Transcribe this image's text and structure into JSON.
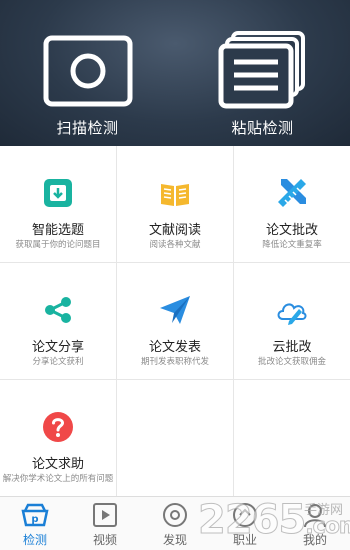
{
  "header": {
    "scan_label": "扫描检测",
    "paste_label": "粘贴检测"
  },
  "grid": {
    "items": [
      {
        "title": "智能选题",
        "subtitle": "获取属于你的论问题目",
        "icon": "topic-icon"
      },
      {
        "title": "文献阅读",
        "subtitle": "阅读各种文献",
        "icon": "book-icon"
      },
      {
        "title": "论文批改",
        "subtitle": "降低论文重复率",
        "icon": "pencil-ruler-icon"
      },
      {
        "title": "论文分享",
        "subtitle": "分享论文获利",
        "icon": "share-icon"
      },
      {
        "title": "论文发表",
        "subtitle": "期刊发表职称代发",
        "icon": "paper-plane-icon"
      },
      {
        "title": "云批改",
        "subtitle": "批改论文获取佣金",
        "icon": "cloud-pen-icon"
      },
      {
        "title": "论文求助",
        "subtitle": "解决你学术论文上的所有问题",
        "icon": "help-icon"
      }
    ]
  },
  "tabbar": {
    "tabs": [
      {
        "label": "检测",
        "active": true
      },
      {
        "label": "视频",
        "active": false
      },
      {
        "label": "发现",
        "active": false
      },
      {
        "label": "职业",
        "active": false
      },
      {
        "label": "我的",
        "active": false
      }
    ]
  },
  "watermark": {
    "number": "2265",
    "suffix": ".com",
    "text": "手游网"
  },
  "colors": {
    "accent": "#1a7fd6",
    "header_bg": "#2c3a4b",
    "green": "#19b3a0",
    "yellow": "#f5b82e",
    "blue": "#2a8de0",
    "red": "#f04848"
  }
}
